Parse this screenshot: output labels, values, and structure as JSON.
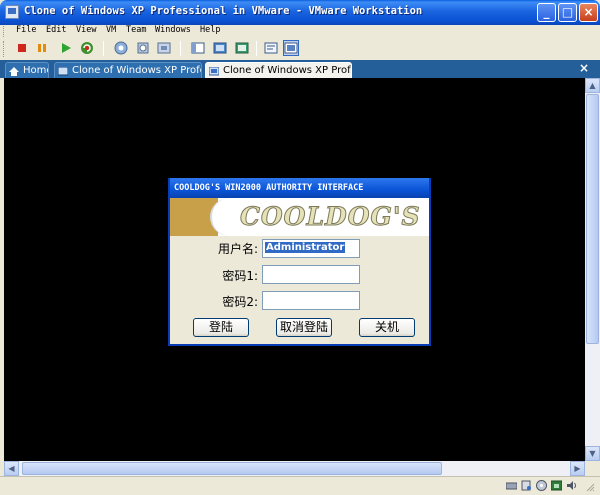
{
  "window": {
    "title": "Clone of Windows XP Professional in VMware - VMware Workstation",
    "minimize": "_",
    "maximize": "□",
    "close": "×"
  },
  "menu": [
    "File",
    "Edit",
    "View",
    "VM",
    "Team",
    "Windows",
    "Help"
  ],
  "toolbar": {
    "buttons": [
      "stop-icon",
      "pause-icon",
      "play-icon",
      "reset-icon",
      "snapshot-icon",
      "revert-snapshot-icon",
      "snapshot-manager-icon",
      "console-view-icon",
      "full-screen-icon",
      "quick-switch-icon",
      "summary-view-icon",
      "console-mode-icon"
    ]
  },
  "tabs": [
    {
      "label": "Home",
      "active": false
    },
    {
      "label": "Clone of Windows XP Profess...",
      "active": false
    },
    {
      "label": "Clone of Windows XP Prof...",
      "active": true
    }
  ],
  "tab_close": "×",
  "dialog": {
    "title": "COOLDOG'S WIN2000 AUTHORITY INTERFACE",
    "logo": "COOLDOG'S",
    "fields": [
      {
        "label": "用户名:",
        "value": "Administrator"
      },
      {
        "label": "密码1:",
        "value": ""
      },
      {
        "label": "密码2:",
        "value": ""
      }
    ],
    "buttons": [
      "登陆",
      "取消登陆",
      "关机"
    ]
  },
  "colors": {
    "title_blue": "#0a54d6",
    "guest_background": "#000000",
    "tab_strip": "#245f9a",
    "banner_gold": "#c8a04a"
  }
}
